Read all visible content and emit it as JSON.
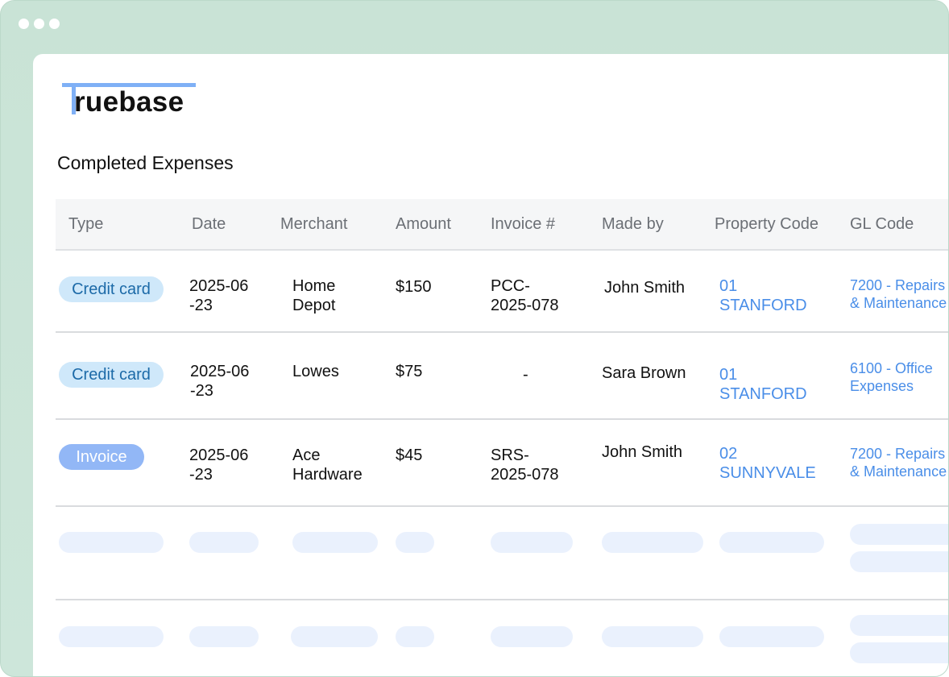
{
  "app": {
    "logo_text": "ruebase"
  },
  "page": {
    "title": "Completed Expenses"
  },
  "table": {
    "columns": [
      "Type",
      "Date",
      "Merchant",
      "Amount",
      "Invoice #",
      "Made by",
      "Property Code",
      "GL Code"
    ],
    "rows": [
      {
        "type": "Credit card",
        "date": "2025-06\n-23",
        "merchant": "Home\nDepot",
        "amount": "$150",
        "invoice": "PCC-\n2025-078",
        "made_by": "John Smith",
        "property_code": "01\nSTANFORD",
        "gl_code": "7200 - Repairs\n& Maintenance"
      },
      {
        "type": "Credit card",
        "date": "2025-06\n-23",
        "merchant": "Lowes",
        "amount": "$75",
        "invoice": "-",
        "made_by": "Sara Brown",
        "property_code": "01\nSTANFORD",
        "gl_code": "6100 - Office\nExpenses"
      },
      {
        "type": "Invoice",
        "date": "2025-06\n-23",
        "merchant": "Ace\nHardware",
        "amount": "$45",
        "invoice": "SRS-\n2025-078",
        "made_by": "John Smith",
        "property_code": "02\nSUNNYVALE",
        "gl_code": "7200 - Repairs\n& Maintenance"
      }
    ],
    "placeholder_rows": 2
  },
  "colors": {
    "frame": "#c9e3d6",
    "logo_accent": "#7fb0f6",
    "credit_badge_bg": "#cfe8fa",
    "credit_badge_text": "#1c6aa8",
    "invoice_badge_bg": "#92b7f6",
    "link": "#4a8ee8",
    "skeleton": "#eaf1fd"
  }
}
